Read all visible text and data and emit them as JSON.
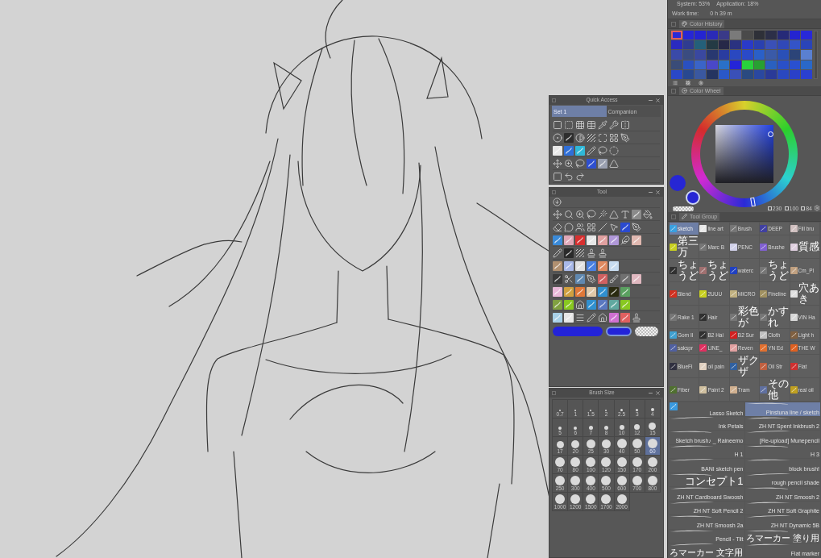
{
  "status": {
    "system": "System: 53%",
    "application": "Application: 18%",
    "work_time_label": "Work time:",
    "work_time": "0 h 39 m"
  },
  "quick_access": {
    "title": "Quick Access",
    "tabs": [
      {
        "label": "Set 1",
        "selected": true
      },
      {
        "label": "Companion",
        "selected": false
      }
    ]
  },
  "tool_palette": {
    "title": "Tool",
    "colors": [
      {
        "kind": "main",
        "color": "#2323d8"
      },
      {
        "kind": "sub",
        "color": "#2323d8"
      },
      {
        "kind": "transparent"
      }
    ]
  },
  "brush_size": {
    "title": "Brush Size",
    "sizes": [
      {
        "label": "0.7",
        "selected": false
      },
      {
        "label": "1",
        "selected": false
      },
      {
        "label": "1.5",
        "selected": false
      },
      {
        "label": "2",
        "selected": false
      },
      {
        "label": "2.5",
        "selected": false
      },
      {
        "label": "3",
        "selected": false
      },
      {
        "label": "4",
        "selected": false
      },
      {
        "label": "5",
        "selected": false
      },
      {
        "label": "6",
        "selected": false
      },
      {
        "label": "7",
        "selected": false
      },
      {
        "label": "8",
        "selected": false
      },
      {
        "label": "10",
        "selected": false
      },
      {
        "label": "12",
        "selected": false
      },
      {
        "label": "15",
        "selected": false
      },
      {
        "label": "17",
        "selected": false
      },
      {
        "label": "20",
        "selected": false
      },
      {
        "label": "25",
        "selected": false
      },
      {
        "label": "30",
        "selected": false
      },
      {
        "label": "40",
        "selected": false
      },
      {
        "label": "50",
        "selected": false
      },
      {
        "label": "60",
        "selected": true
      },
      {
        "label": "70",
        "selected": false
      },
      {
        "label": "80",
        "selected": false
      },
      {
        "label": "100",
        "selected": false
      },
      {
        "label": "120",
        "selected": false
      },
      {
        "label": "150",
        "selected": false
      },
      {
        "label": "170",
        "selected": false
      },
      {
        "label": "200",
        "selected": false
      },
      {
        "label": "250",
        "selected": false
      },
      {
        "label": "300",
        "selected": false
      },
      {
        "label": "400",
        "selected": false
      },
      {
        "label": "500",
        "selected": false
      },
      {
        "label": "600",
        "selected": false
      },
      {
        "label": "700",
        "selected": false
      },
      {
        "label": "800",
        "selected": false
      },
      {
        "label": "1000",
        "selected": false
      },
      {
        "label": "1200",
        "selected": false
      },
      {
        "label": "1500",
        "selected": false
      },
      {
        "label": "1700",
        "selected": false
      },
      {
        "label": "2000",
        "selected": false
      }
    ]
  },
  "color_history": {
    "title": "Color History",
    "swatches": [
      {
        "color": "#2a2ad8",
        "selected": true
      },
      {
        "color": "#2626d6",
        "selected": false
      },
      {
        "color": "#2424d2",
        "selected": false
      },
      {
        "color": "#2a2ab8",
        "selected": false
      },
      {
        "color": "#3a3a88",
        "selected": false
      },
      {
        "color": "#7a7a7a",
        "selected": false
      },
      {
        "color": "#4a4a4a",
        "selected": false
      },
      {
        "color": "#2e3038",
        "selected": false
      },
      {
        "color": "#2c2f48",
        "selected": false
      },
      {
        "color": "#262a78",
        "selected": false
      },
      {
        "color": "#2424d0",
        "selected": false
      },
      {
        "color": "#2828d8",
        "selected": false
      },
      {
        "color": "#2a2ac0",
        "selected": false
      },
      {
        "color": "#2f3c90",
        "selected": false
      },
      {
        "color": "#24607a",
        "selected": false
      },
      {
        "color": "#243a44",
        "selected": false
      },
      {
        "color": "#262848",
        "selected": false
      },
      {
        "color": "#2a3280",
        "selected": false
      },
      {
        "color": "#2a3ac8",
        "selected": false
      },
      {
        "color": "#2a40b0",
        "selected": false
      },
      {
        "color": "#3a50b8",
        "selected": false
      },
      {
        "color": "#3048b8",
        "selected": false
      },
      {
        "color": "#3454c8",
        "selected": false
      },
      {
        "color": "#2a44b8",
        "selected": false
      },
      {
        "color": "#3a4aa8",
        "selected": false
      },
      {
        "color": "#3a4c80",
        "selected": false
      },
      {
        "color": "#3a48a0",
        "selected": false
      },
      {
        "color": "#283870",
        "selected": false
      },
      {
        "color": "#2a3ca0",
        "selected": false
      },
      {
        "color": "#2a48c0",
        "selected": false
      },
      {
        "color": "#2a4ac8",
        "selected": false
      },
      {
        "color": "#2a60c8",
        "selected": false
      },
      {
        "color": "#3a5aa8",
        "selected": false
      },
      {
        "color": "#2a50b8",
        "selected": false
      },
      {
        "color": "#2c4478",
        "selected": false
      },
      {
        "color": "#5a80d0",
        "selected": false
      },
      {
        "color": "#3a4c78",
        "selected": false
      },
      {
        "color": "#2a50c0",
        "selected": false
      },
      {
        "color": "#3a64c8",
        "selected": false
      },
      {
        "color": "#4a48c8",
        "selected": false
      },
      {
        "color": "#2a70c8",
        "selected": false
      },
      {
        "color": "#2424d8",
        "selected": false
      },
      {
        "color": "#28d23c",
        "selected": false
      },
      {
        "color": "#28a032",
        "selected": false
      },
      {
        "color": "#2a60c0",
        "selected": false
      },
      {
        "color": "#2a50c8",
        "selected": false
      },
      {
        "color": "#2a50d0",
        "selected": false
      },
      {
        "color": "#2a68c8",
        "selected": false
      },
      {
        "color": "#2a48c8",
        "selected": false
      },
      {
        "color": "#284890",
        "selected": false
      },
      {
        "color": "#3a58a0",
        "selected": false
      },
      {
        "color": "#243460",
        "selected": false
      },
      {
        "color": "#2a58c8",
        "selected": false
      },
      {
        "color": "#3a50b8",
        "selected": false
      },
      {
        "color": "#2a4a80",
        "selected": false
      },
      {
        "color": "#2a48a0",
        "selected": false
      },
      {
        "color": "#2a3a98",
        "selected": false
      },
      {
        "color": "#2a48c0",
        "selected": false
      },
      {
        "color": "#2a40c8",
        "selected": false
      },
      {
        "color": "#2a40d0",
        "selected": false
      }
    ]
  },
  "color_wheel": {
    "title": "Color Wheel",
    "hue": {
      "level": 0.64
    },
    "colors": [
      {
        "kind": "main",
        "color": "#2626d4"
      },
      {
        "kind": "sub",
        "color": "#2626d4"
      },
      {
        "kind": "transparent"
      }
    ],
    "readings": [
      "230",
      "100",
      "84"
    ]
  },
  "tool_group": {
    "title": "Tool Group",
    "items": [
      {
        "label": "sketch",
        "selected": true
      },
      {
        "label": "line art",
        "selected": false
      },
      {
        "label": "Brush",
        "selected": false
      },
      {
        "label": "DEEP",
        "selected": false
      },
      {
        "label": "Fill bru",
        "selected": false
      },
      {
        "label": "第三万",
        "selected": false
      },
      {
        "label": "Marc B",
        "selected": false
      },
      {
        "label": "PENC",
        "selected": false
      },
      {
        "label": "Brushe",
        "selected": false
      },
      {
        "label": "質感",
        "selected": false
      },
      {
        "label": "ちょうど",
        "selected": false
      },
      {
        "label": "ちょうど",
        "selected": false
      },
      {
        "label": "waterc",
        "selected": false
      },
      {
        "label": "ちょうど",
        "selected": false
      },
      {
        "label": "Cm_Pl",
        "selected": false
      },
      {
        "label": "Blend",
        "selected": false
      },
      {
        "label": "2UUU",
        "selected": false
      },
      {
        "label": "MICRO",
        "selected": false
      },
      {
        "label": "Fineline",
        "selected": false
      },
      {
        "label": "穴あき",
        "selected": false
      },
      {
        "label": "Rake 1",
        "selected": false
      },
      {
        "label": "Hair",
        "selected": false
      },
      {
        "label": "彩色が",
        "selected": false
      },
      {
        "label": "かすれ",
        "selected": false
      },
      {
        "label": "VIN Ha",
        "selected": false
      },
      {
        "label": "Gom II",
        "selected": false
      },
      {
        "label": "B2 Hai",
        "selected": false
      },
      {
        "label": "B2 Sur",
        "selected": false
      },
      {
        "label": "Cloth",
        "selected": false
      },
      {
        "label": "Light h",
        "selected": false
      },
      {
        "label": "sakspr",
        "selected": false
      },
      {
        "label": "LINE_",
        "selected": false
      },
      {
        "label": "Reven",
        "selected": false
      },
      {
        "label": "YN Ed",
        "selected": false
      },
      {
        "label": "THE W",
        "selected": false
      },
      {
        "label": "BlueFl",
        "selected": false
      },
      {
        "label": "oil pain",
        "selected": false
      },
      {
        "label": "ザクザ",
        "selected": false
      },
      {
        "label": "Oil Str",
        "selected": false
      },
      {
        "label": "Flat",
        "selected": false
      },
      {
        "label": "Fiber",
        "selected": false
      },
      {
        "label": "Paint 2",
        "selected": false
      },
      {
        "label": "Tram",
        "selected": false
      },
      {
        "label": "その他",
        "selected": false
      },
      {
        "label": "real oil",
        "selected": false
      }
    ]
  },
  "brushes": [
    {
      "kind": "picture",
      "name": "Lasso Sketch",
      "selected": false
    },
    {
      "kind": "stroke",
      "name": "Pinstuna line / sketch",
      "selected": true
    },
    {
      "kind": "stroke",
      "name": "Ink Petals",
      "selected": false
    },
    {
      "kind": "stroke",
      "name": "ZH NT Spent Inkbrush 2",
      "selected": false
    },
    {
      "kind": "stroke",
      "name": "Sketch brush♪ _ Raineemo",
      "selected": false
    },
    {
      "kind": "stroke",
      "name": "[Re-upload] Munepencil",
      "selected": false
    },
    {
      "kind": "stroke",
      "name": "H 1",
      "selected": false
    },
    {
      "kind": "stroke",
      "name": "H 3",
      "selected": false
    },
    {
      "kind": "stroke",
      "name": "BANI sketch pen",
      "selected": false
    },
    {
      "kind": "stroke",
      "name": "block brush!",
      "selected": false
    },
    {
      "kind": "stroke",
      "name": "コンセプト1",
      "selected": false
    },
    {
      "kind": "stroke",
      "name": "rough pencil shade",
      "selected": false
    },
    {
      "kind": "stroke",
      "name": "ZH NT Cardboard Swoosh",
      "selected": false
    },
    {
      "kind": "stroke",
      "name": "ZH NT Smoosh 2",
      "selected": false
    },
    {
      "kind": "stroke",
      "name": "ZH NT Soft Pencil 2",
      "selected": false
    },
    {
      "kind": "stroke",
      "name": "ZH NT Soft Graphite",
      "selected": false
    },
    {
      "kind": "stroke",
      "name": "ZH NT Smoosh 2a",
      "selected": false
    },
    {
      "kind": "stroke",
      "name": "ZH NT Dynamic 5B",
      "selected": false
    },
    {
      "kind": "stroke",
      "name": "Pencil - Tilt",
      "selected": false
    },
    {
      "kind": "stroke",
      "name": "ろマーカー 塗り用",
      "selected": false
    },
    {
      "kind": "stroke",
      "name": "ろマーカー 文字用",
      "selected": false
    },
    {
      "kind": "stroke",
      "name": "Flat marker",
      "selected": false
    }
  ]
}
